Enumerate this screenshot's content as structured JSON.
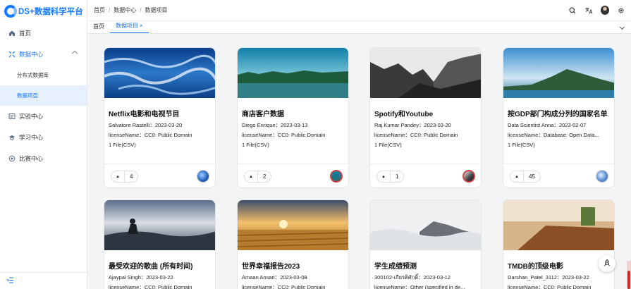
{
  "app": {
    "logo_text": "DS+数据科学平台"
  },
  "sidebar": {
    "items": [
      {
        "label": "首页",
        "icon": "home-icon"
      },
      {
        "label": "数据中心",
        "icon": "expand-icon",
        "open": true,
        "children": [
          {
            "label": "分布式数据库"
          },
          {
            "label": "数据项目",
            "active": true
          }
        ]
      },
      {
        "label": "实验中心",
        "icon": "lab-icon"
      },
      {
        "label": "学习中心",
        "icon": "learn-icon"
      },
      {
        "label": "比赛中心",
        "icon": "competition-icon"
      }
    ],
    "bottom_icon": "menu-fold-icon"
  },
  "header": {
    "breadcrumb": [
      "首页",
      "数据中心",
      "数据项目"
    ],
    "tools": [
      "search-icon",
      "translate-icon",
      "user-avatar",
      "settings-icon"
    ]
  },
  "tabs": [
    {
      "label": "首页"
    },
    {
      "label": "数据项目",
      "active": true,
      "close": "×"
    }
  ],
  "cards": [
    {
      "title": "Netflix电影和电视节目",
      "author": "Salvatore Rastelli：2023-03-20",
      "license": "licenseName：CC0: Public Domain",
      "files": "1 File(CSV)",
      "votes": "4"
    },
    {
      "title": "商店客户数据",
      "author": "Diego Enrique：2023-03-13",
      "license": "licenseName：CC0: Public Domain",
      "files": "1 File(CSV)",
      "votes": "2"
    },
    {
      "title": "Spotify和Youtube",
      "author": "Raj Kumar Pandey：2023-03-20",
      "license": "licenseName：CC0: Public Domain",
      "files": "1 File(CSV)",
      "votes": "1"
    },
    {
      "title": "按GDP部门构成分列的国家名单",
      "author": "Data Scientist Anna：2023-02-07",
      "license": "licenseName：Database: Open Data...",
      "files": "1 File(CSV)",
      "votes": "45"
    },
    {
      "title": "最受欢迎的歌曲 (所有时间)",
      "author": "Ajaypal Singh：2023-03-22",
      "license": "licenseName：CC0: Public Domain",
      "files": ""
    },
    {
      "title": "世界幸福报告2023",
      "author": "Amaan Ansari：2023-03-08",
      "license": "licenseName：CC0: Public Domain",
      "files": ""
    },
    {
      "title": "学生成绩预测",
      "author": "300102-เกียรติศักดิ์：2023-03-12",
      "license": "licenseName：Other (specified in de...",
      "files": ""
    },
    {
      "title": "TMDB的顶级电影",
      "author": "Darshan_Patel_3112：2023-03-22",
      "license": "licenseName：CC0: Public Domain",
      "files": ""
    }
  ],
  "fab_icon": "rocket-icon"
}
